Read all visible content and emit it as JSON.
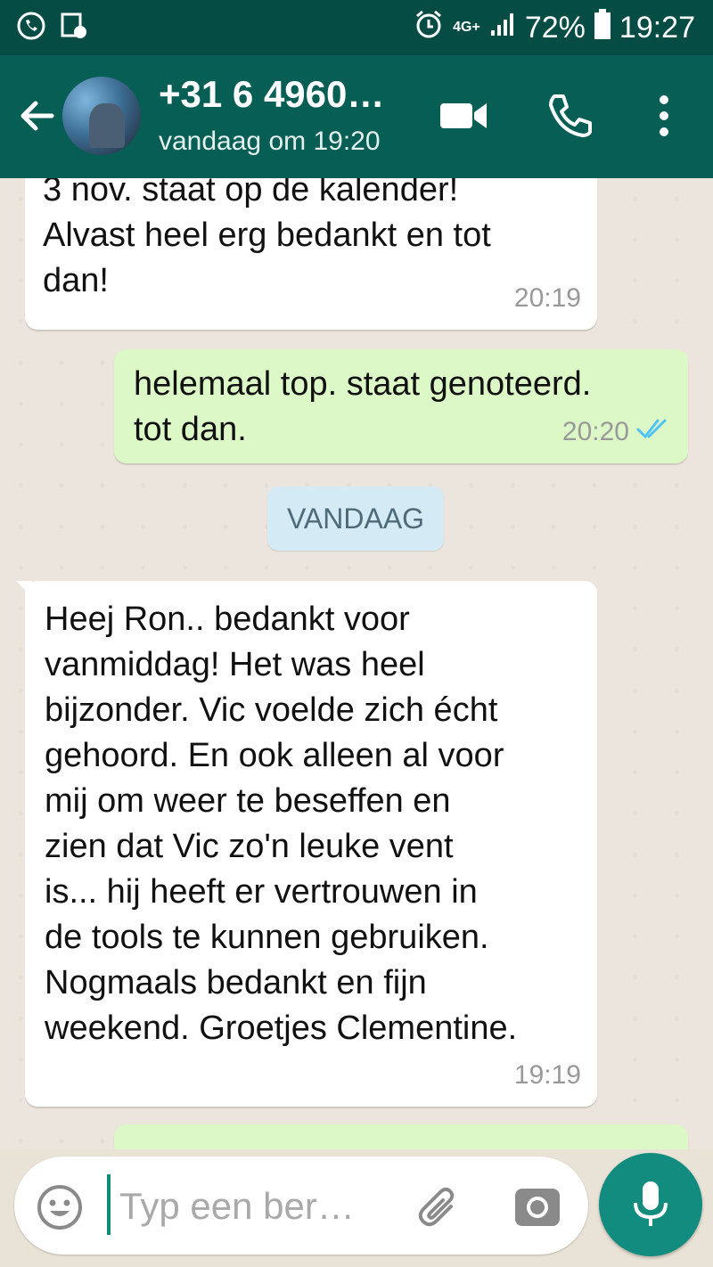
{
  "status_bar": {
    "network": "4G+",
    "battery": "72%",
    "time": "19:27"
  },
  "header": {
    "contact_name": "+31 6 4960…",
    "last_seen": "vandaag om 19:20"
  },
  "messages": [
    {
      "direction": "in",
      "text": "3 nov. staat op de kalender!\nAlvast heel erg bedankt en tot\ndan!",
      "time": "20:19"
    },
    {
      "direction": "out",
      "text": "helemaal top. staat genoteerd.\ntot dan.",
      "time": "20:20",
      "read": true
    },
    {
      "direction": "in",
      "text": "Heej Ron.. bedankt voor\nvanmiddag! Het was heel\nbijzonder. Vic voelde zich écht\ngehoord. En ook alleen al voor\nmij om weer te beseffen en\nzien dat Vic zo'n leuke vent\nis... hij heeft er vertrouwen in\nde tools te kunnen gebruiken.\nNogmaals bedankt en fijn\nweekend. Groetjes Clementine.",
      "time": "19:19"
    }
  ],
  "date_divider": "VANDAAG",
  "composer": {
    "placeholder": "Typ een ber…"
  },
  "colors": {
    "header": "#075e54",
    "status_bar": "#054d44",
    "incoming": "#ffffff",
    "outgoing": "#dcf8c6",
    "accent": "#128c7e",
    "read_ticks": "#4fc3f7"
  },
  "icons": [
    "back-arrow-icon",
    "video-call-icon",
    "phone-icon",
    "more-vert-icon",
    "emoji-icon",
    "attach-icon",
    "camera-icon",
    "mic-icon"
  ]
}
